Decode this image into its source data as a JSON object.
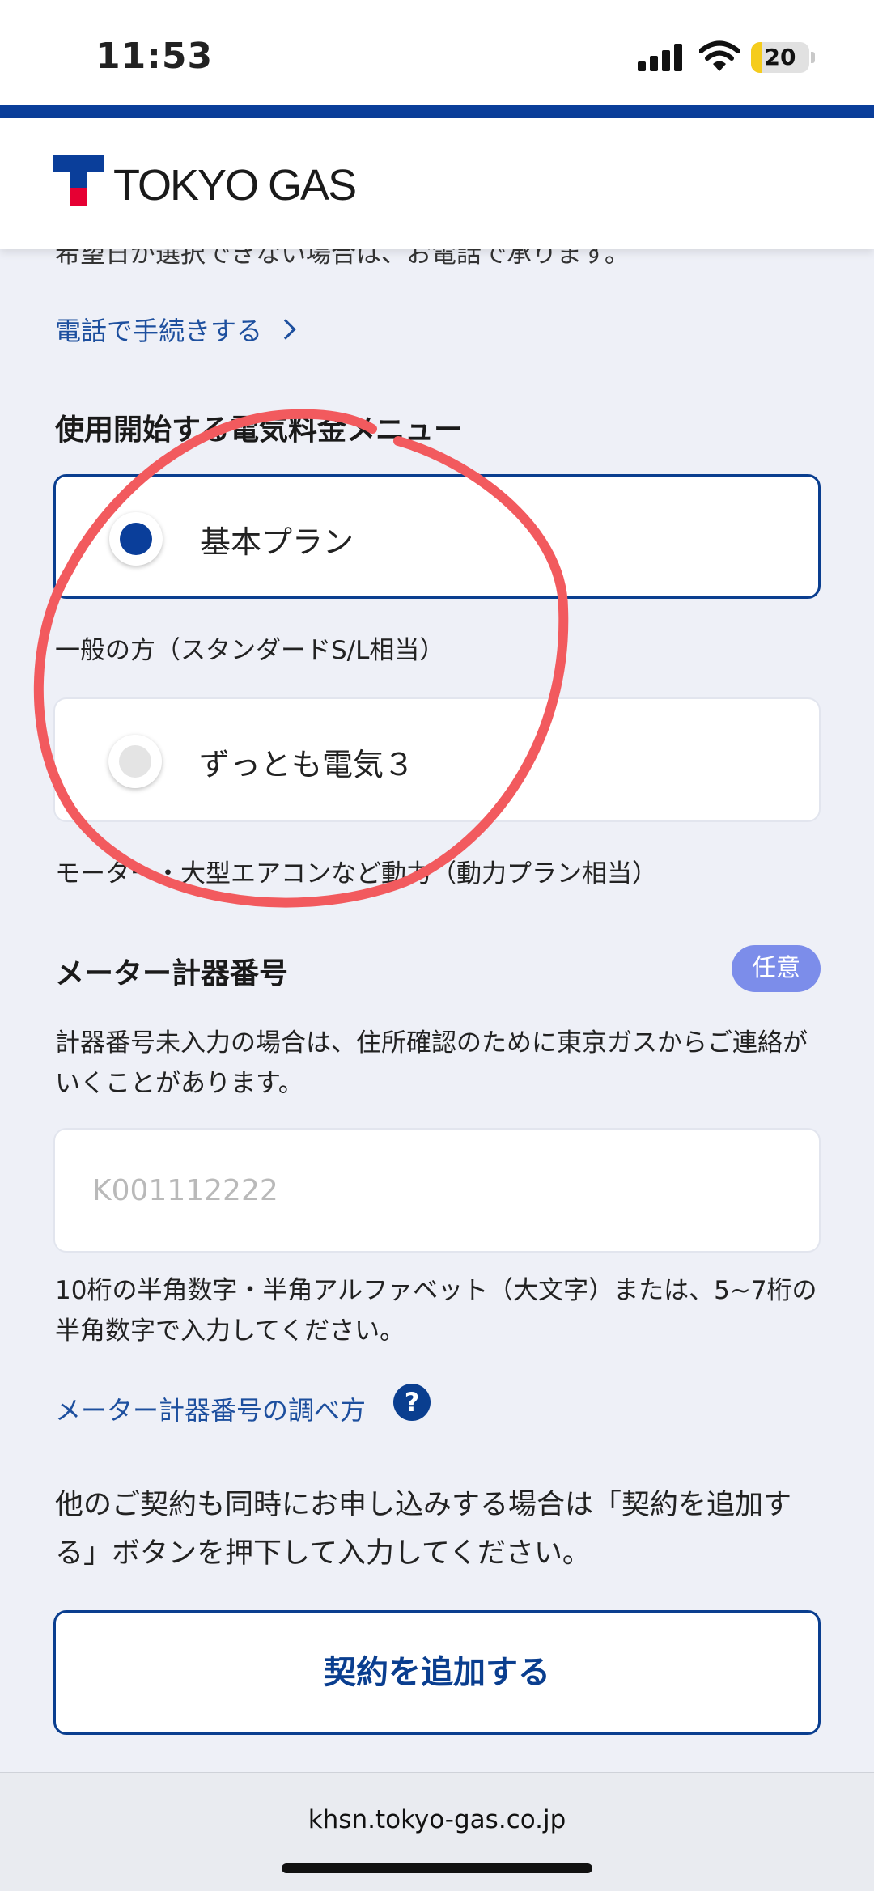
{
  "status_bar": {
    "time": "11:53",
    "battery_level": "20",
    "battery_fraction": 0.2
  },
  "header": {
    "brand": "TOKYO GAS",
    "logo_colors": {
      "blue": "#0a3e9a",
      "red": "#e60033"
    }
  },
  "notice_cut": "希望日が選択できない場合は、お電話で承ります。",
  "phone_link": "電話で手続きする",
  "plan_section": {
    "title": "使用開始する電気料金メニュー",
    "options": [
      {
        "label": "基本プラン",
        "selected": true,
        "description": "一般の方（スタンダードS/L相当）"
      },
      {
        "label": "ずっとも電気３",
        "selected": false,
        "description": "モーター・大型エアコンなど動力（動力プラン相当）"
      }
    ]
  },
  "meter_section": {
    "title": "メーター計器番号",
    "badge": "任意",
    "note": "計器番号未入力の場合は、住所確認のために東京ガスからご連絡がいくことがあります。",
    "placeholder": "K001112222",
    "value": "",
    "hint": "10桁の半角数字・半角アルファベット（大文字）または、5~7桁の半角数字で入力してください。",
    "howto_link": "メーター計器番号の調べ方",
    "help_glyph": "?"
  },
  "add_contract": {
    "instruction": "他のご契約も同時にお申し込みする場合は「契約を追加する」ボタンを押下して入力してください。",
    "button_label": "契約を追加する"
  },
  "browser": {
    "url": "khsn.tokyo-gas.co.jp"
  },
  "colors": {
    "accent": "#0a3e9a",
    "link": "#1d4f9e",
    "badge": "#7c8dea",
    "annotation": "#f25a5e"
  }
}
